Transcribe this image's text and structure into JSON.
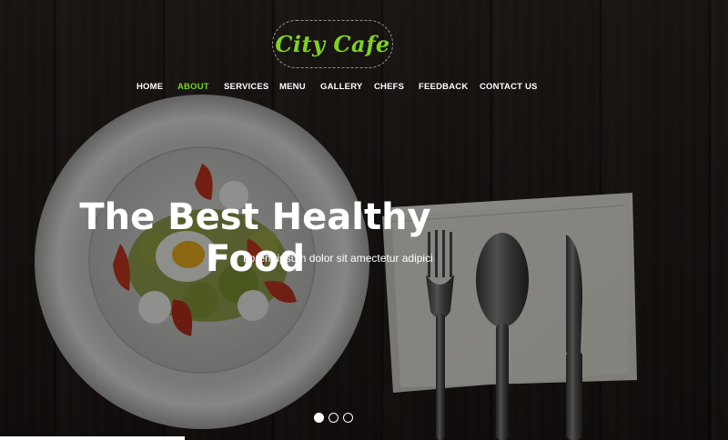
{
  "brand": {
    "logo_text": "City Cafe"
  },
  "nav": {
    "items": [
      {
        "label": "HOME",
        "active": false
      },
      {
        "label": "ABOUT",
        "active": true
      },
      {
        "label": "SERVICES",
        "active": false
      },
      {
        "label": "MENU",
        "active": false
      },
      {
        "label": "GALLERY",
        "active": false
      },
      {
        "label": "CHEFS",
        "active": false
      },
      {
        "label": "FEEDBACK",
        "active": false
      },
      {
        "label": "CONTACT US",
        "active": false
      }
    ]
  },
  "hero": {
    "headline": "The Best Healthy Food",
    "subline": "Lorem ipsum dolor sit amectetur adipici",
    "slides": {
      "count": 3,
      "active_index": 0
    }
  },
  "colors": {
    "accent": "#7ed321",
    "text": "#ffffff",
    "background": "#221c19"
  },
  "icons": [
    "plate-image",
    "fork-icon",
    "spoon-icon",
    "knife-icon",
    "napkin-image"
  ]
}
